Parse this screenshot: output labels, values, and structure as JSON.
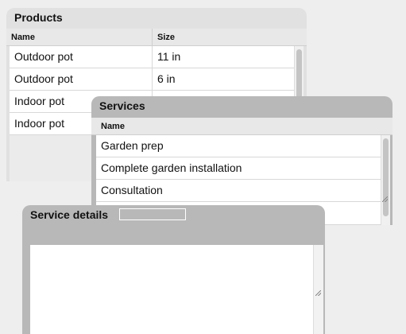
{
  "products": {
    "title": "Products",
    "columns": [
      "Name",
      "Size"
    ],
    "rows": [
      {
        "name": "Outdoor pot",
        "size": "11 in"
      },
      {
        "name": "Outdoor pot",
        "size": "6 in"
      },
      {
        "name": "Indoor pot",
        "size": ""
      },
      {
        "name": "Indoor pot",
        "size": ""
      }
    ]
  },
  "services": {
    "title": "Services",
    "columns": [
      "Name"
    ],
    "rows": [
      {
        "name": "Garden prep"
      },
      {
        "name": "Complete garden installation"
      },
      {
        "name": "Consultation"
      }
    ]
  },
  "service_details": {
    "title": "Service details",
    "name_value": "",
    "description_value": ""
  }
}
